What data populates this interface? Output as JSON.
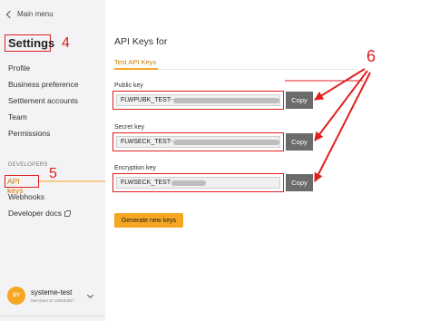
{
  "sidebar": {
    "back_label": "Main menu",
    "title": "Settings",
    "items": [
      {
        "label": "Profile"
      },
      {
        "label": "Business preference"
      },
      {
        "label": "Settlement accounts"
      },
      {
        "label": "Team"
      },
      {
        "label": "Permissions"
      }
    ],
    "section_label": "DEVELOPERS",
    "dev_items": [
      {
        "label": "API keys",
        "active": true
      },
      {
        "label": "Webhooks"
      },
      {
        "label": "Developer docs"
      }
    ],
    "user": {
      "initials": "SY",
      "name": "systeme-test",
      "merchant": "Merchant ID 100030817"
    }
  },
  "main": {
    "title": "API Keys for",
    "tab": "Test API Keys",
    "fields": [
      {
        "label": "Public key",
        "prefix": "FLWPUBK_TEST-",
        "copy_label": "Copy"
      },
      {
        "label": "Secret key",
        "prefix": "FLWSECK_TEST-",
        "copy_label": "Copy"
      },
      {
        "label": "Encryption key",
        "prefix": "FLWSECK_TEST",
        "copy_label": "Copy"
      }
    ],
    "generate_label": "Generate new keys"
  },
  "annotations": {
    "settings_number": "4",
    "api_keys_number": "5",
    "keys_number": "6",
    "color": "#e02020"
  },
  "colors": {
    "accent": "#f5a623",
    "accent_text": "#d07a00",
    "copy_button": "#6b6b6b",
    "annotation": "#e02020"
  }
}
